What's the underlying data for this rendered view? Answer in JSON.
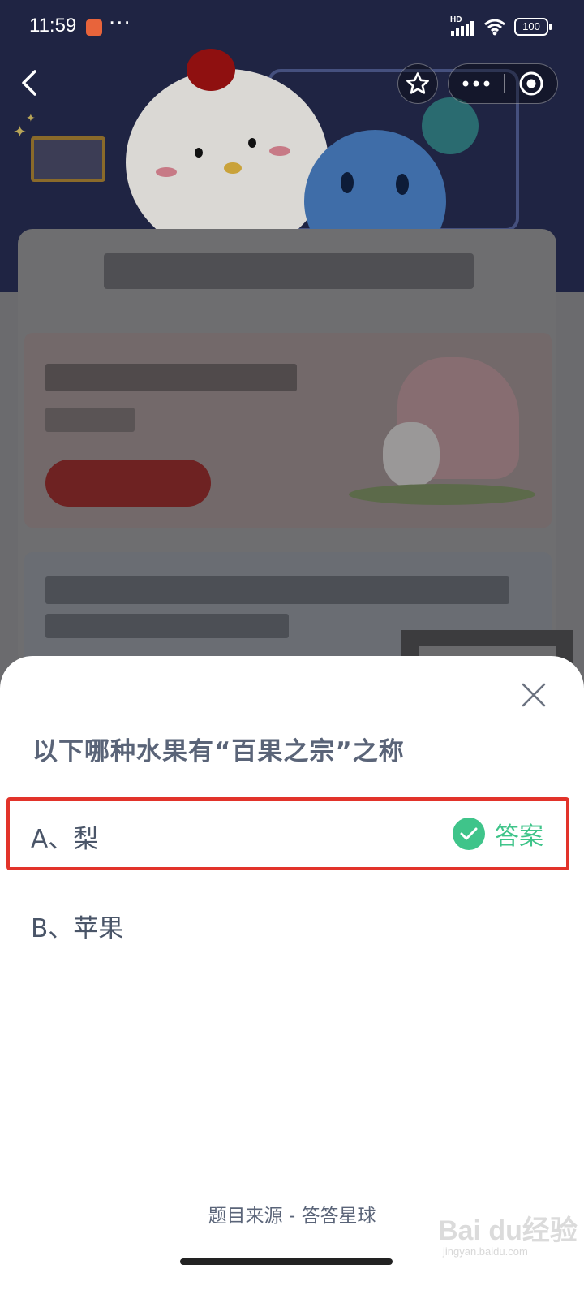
{
  "status_bar": {
    "time": "11:59",
    "more": "···",
    "network": "HD",
    "battery": "100"
  },
  "icons": {
    "back": "chevron-left-icon",
    "favorite": "star-icon",
    "more": "more-dots-icon",
    "close_miniprogram": "target-circle-icon",
    "close_sheet": "close-x-icon",
    "answer_check": "check-circle-icon"
  },
  "sheet": {
    "question": "以下哪种水果有“百果之宗”之称",
    "options": [
      {
        "label": "A、梨",
        "is_answer": true,
        "tag": "答案"
      },
      {
        "label": "B、苹果",
        "is_answer": false
      }
    ],
    "source": "题目来源 - 答答星球"
  },
  "watermark": {
    "main": "Bai du经验",
    "sub": "jingyan.baidu.com"
  },
  "colors": {
    "accent_green": "#3fc48a",
    "highlight_red": "#e2332a",
    "text": "#5a6478"
  }
}
